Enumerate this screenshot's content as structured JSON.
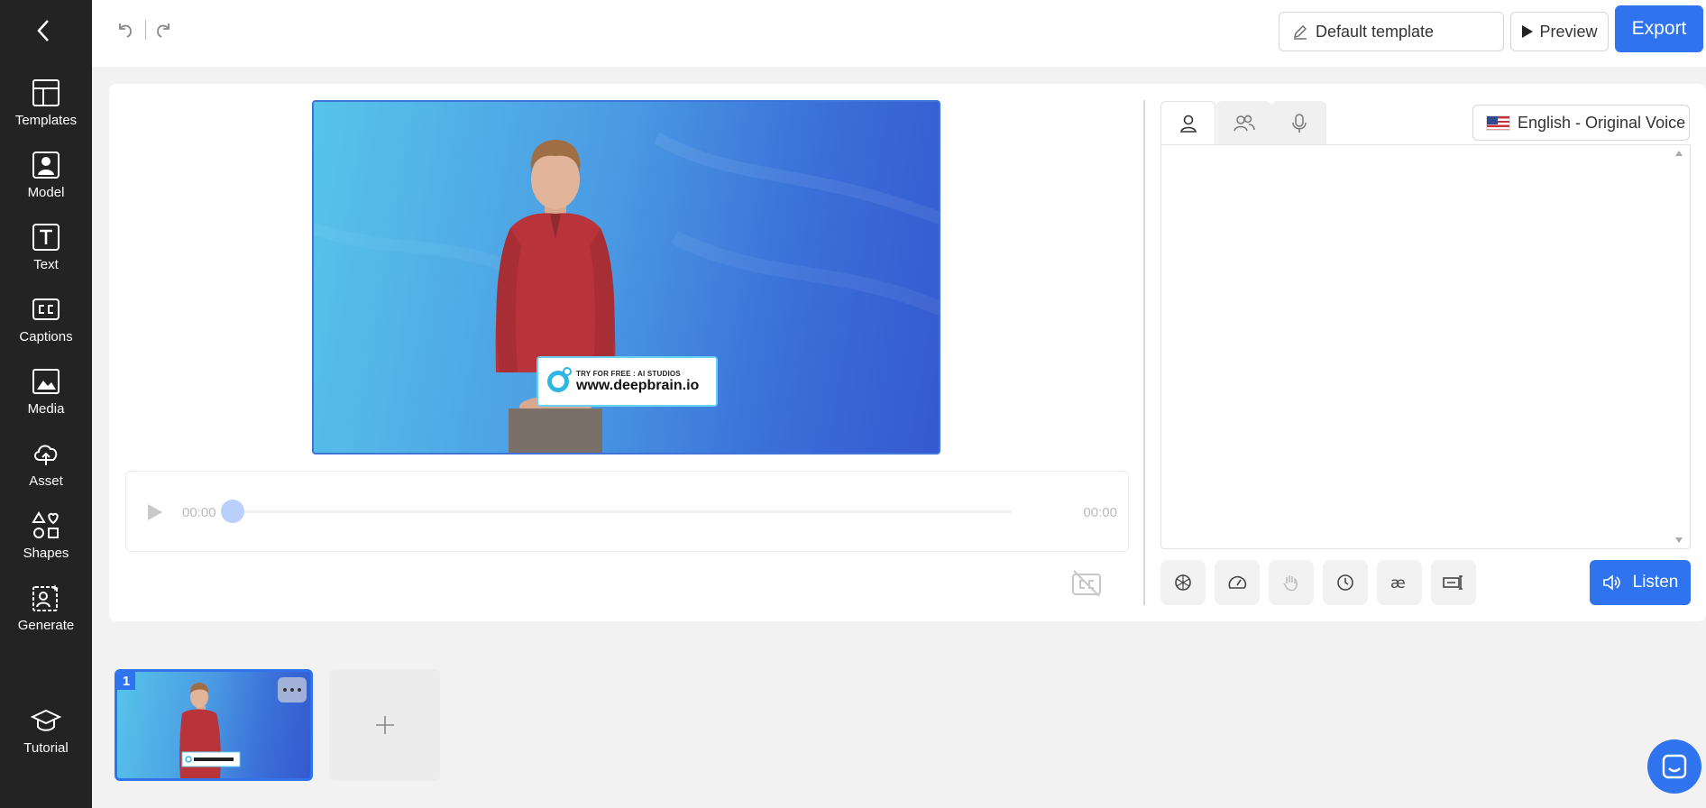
{
  "sidebar": {
    "items": [
      {
        "label": "Templates",
        "icon": "templates-icon"
      },
      {
        "label": "Model",
        "icon": "model-icon"
      },
      {
        "label": "Text",
        "icon": "text-icon"
      },
      {
        "label": "Captions",
        "icon": "captions-icon"
      },
      {
        "label": "Media",
        "icon": "media-icon"
      },
      {
        "label": "Asset",
        "icon": "upload-cloud-icon"
      },
      {
        "label": "Shapes",
        "icon": "shapes-icon"
      },
      {
        "label": "Generate",
        "icon": "generate-icon"
      }
    ],
    "tutorial": {
      "label": "Tutorial",
      "icon": "graduation-cap-icon"
    }
  },
  "topbar": {
    "template_label": "Default template",
    "preview_label": "Preview",
    "export_label": "Export"
  },
  "player": {
    "time_current": "00:00",
    "time_total": "00:00",
    "progress": 0
  },
  "video": {
    "banner_small": "TRY FOR FREE : AI STUDIOS",
    "banner_url": "www.deepbrain.io"
  },
  "script": {
    "language_label": "English - Original Voice",
    "text": "",
    "listen_label": "Listen"
  },
  "scenes": [
    {
      "number": "1"
    }
  ],
  "colors": {
    "accent": "#2f74ee",
    "sidebar_bg": "#232323"
  }
}
